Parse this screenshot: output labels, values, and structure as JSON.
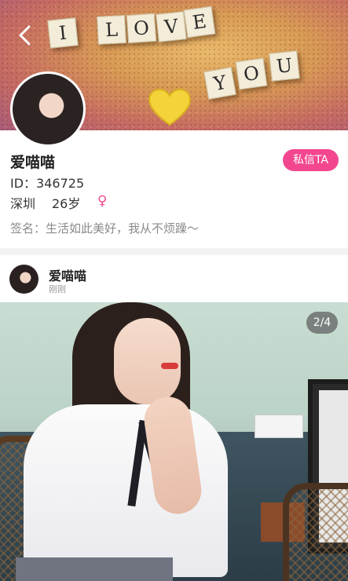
{
  "banner": {
    "tiles_row1": [
      "I",
      "L",
      "O",
      "V",
      "E"
    ],
    "tiles_row2": [
      "Y",
      "O",
      "U"
    ]
  },
  "profile": {
    "name": "爱喵喵",
    "id_text": "ID：346725",
    "city": "深圳",
    "age": "26岁",
    "gender_symbol": "♀",
    "signature": "签名：生活如此美好，我从不烦躁～",
    "message_button": "私信TA"
  },
  "post": {
    "author": "爱喵喵",
    "time": "刚刚",
    "image_page": "2/4"
  },
  "colors": {
    "accent": "#f2478f",
    "secondary_text": "#8a8a8a"
  }
}
